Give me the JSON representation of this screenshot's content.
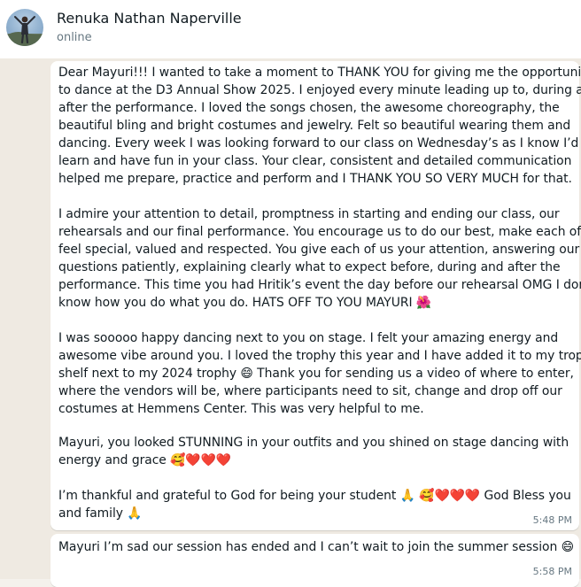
{
  "header": {
    "contact_name": "Renuka Nathan Naperville",
    "status": "online"
  },
  "messages": [
    {
      "paragraphs": [
        [
          "Dear Mayuri!!! I wanted to take a moment to THANK YOU for giving me the opportunity",
          "to dance at the D3 Annual Show 2025. I enjoyed every minute leading up to, during and",
          "after the performance. I loved the songs chosen, the awesome choreography, the",
          "beautiful bling and bright costumes and jewelry. Felt so beautiful wearing them and",
          "dancing. Every week I was looking forward to our class on Wednesday’s as I know I’d",
          "learn and have fun in your class. Your clear, consistent and detailed communication",
          "helped me prepare, practice and perform and I THANK YOU SO VERY MUCH for that."
        ],
        [
          "I admire your attention to detail, promptness in starting and ending our class, our",
          "rehearsals and our final performance. You encourage us to do our best, make each of us",
          "feel special, valued and respected. You give each of us your attention, answering our",
          "questions patiently, explaining clearly what to expect before, during and after the",
          "performance. This time you had Hritik’s event the day before our rehearsal OMG I don’t",
          "know how you do what you do. HATS OFF TO YOU MAYURI 🌺"
        ],
        [
          "I was sooooo happy dancing next to you on stage. I felt your amazing energy and",
          "awesome vibe around you. I loved the trophy this year and I have added it to my trophy",
          "shelf next to my 2024 trophy 😄 Thank you for sending us a video of where to enter,",
          "where the vendors will be, where participants need to sit, change and drop off our",
          "costumes at Hemmens Center. This was very helpful to me."
        ],
        [
          "Mayuri, you looked STUNNING in your outfits and you shined on stage dancing with",
          "energy and grace 🥰❤️❤️❤️"
        ],
        [
          "I’m thankful and grateful to God for being your student 🙏 🥰❤️❤️❤️ God Bless you",
          "and family 🙏"
        ]
      ],
      "time": "5:48 PM"
    },
    {
      "paragraphs": [
        [
          "Mayuri I’m sad our session has ended and I can’t wait to join the summer session 😄"
        ]
      ],
      "time": "5:58 PM"
    }
  ],
  "colors": {
    "chat_background": "#efeae2",
    "bubble": "#ffffff",
    "text": "#111b21",
    "muted": "#667781"
  }
}
